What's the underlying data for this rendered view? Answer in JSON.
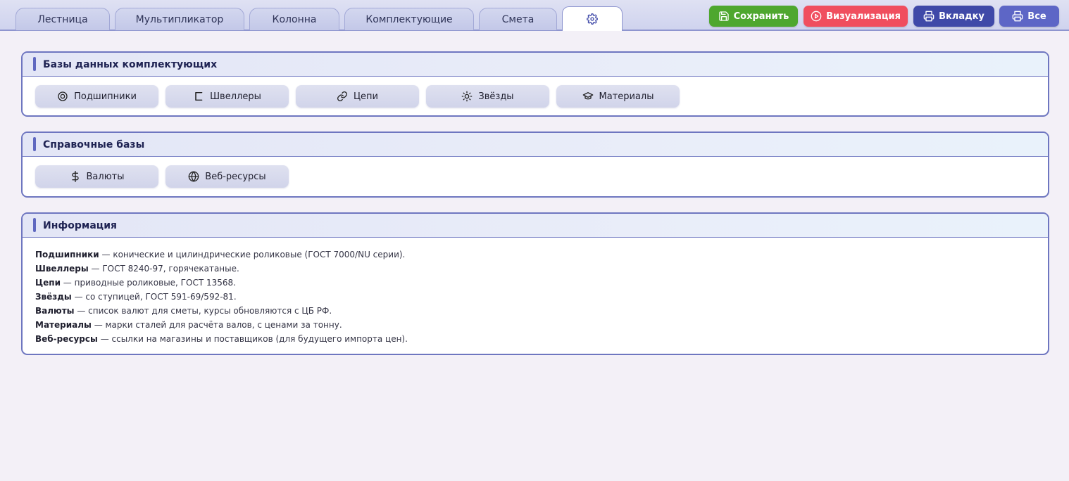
{
  "tabs": [
    {
      "label": "Лестница"
    },
    {
      "label": "Мультипликатор"
    },
    {
      "label": "Колонна"
    },
    {
      "label": "Комплектующие"
    },
    {
      "label": "Смета"
    }
  ],
  "active_tab_icon": "gear-icon",
  "actions": {
    "save": "Сохранить",
    "visualize": "Визуализация",
    "print_tab": "Вкладку",
    "print_all": "Все"
  },
  "colors": {
    "save": "#4ea72e",
    "visualize": "#f04e5e",
    "print_tab": "#3f49a8",
    "print_all": "#5d66c6",
    "panel_border": "#6e76c0"
  },
  "components_db": {
    "title": "Базы данных комплектующих",
    "buttons": [
      {
        "label": "Подшипники",
        "icon": "bearing-icon"
      },
      {
        "label": "Швеллеры",
        "icon": "channel-icon"
      },
      {
        "label": "Цепи",
        "icon": "chain-link-icon"
      },
      {
        "label": "Звёзды",
        "icon": "sprocket-icon"
      },
      {
        "label": "Материалы",
        "icon": "material-icon"
      }
    ]
  },
  "reference_db": {
    "title": "Справочные базы",
    "buttons": [
      {
        "label": "Валюты",
        "icon": "dollar-icon"
      },
      {
        "label": "Веб-ресурсы",
        "icon": "globe-icon"
      }
    ]
  },
  "info": {
    "title": "Информация",
    "lines": [
      {
        "term": "Подшипники",
        "desc": " — конические и цилиндрические роликовые (ГОСТ 7000/NU серии)."
      },
      {
        "term": "Швеллеры",
        "desc": " — ГОСТ 8240-97, горячекатаные."
      },
      {
        "term": "Цепи",
        "desc": " — приводные роликовые, ГОСТ 13568."
      },
      {
        "term": "Звёзды",
        "desc": " — со ступицей, ГОСТ 591-69/592-81."
      },
      {
        "term": "Валюты",
        "desc": " — список валют для сметы, курсы обновляются с ЦБ РФ."
      },
      {
        "term": "Материалы",
        "desc": " — марки сталей для расчёта валов, с ценами за тонну."
      },
      {
        "term": "Веб-ресурсы",
        "desc": " — ссылки на магазины и поставщиков (для будущего импорта цен)."
      }
    ]
  }
}
